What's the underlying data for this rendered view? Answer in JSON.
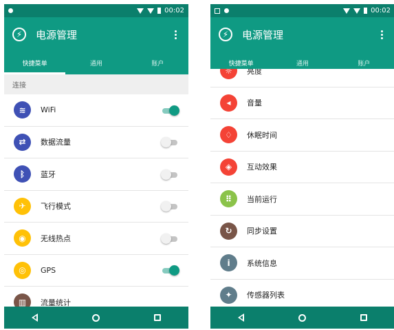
{
  "status": {
    "time": "00:02"
  },
  "app": {
    "title": "电源管理"
  },
  "tabs": [
    {
      "label": "快捷菜单"
    },
    {
      "label": "通用"
    },
    {
      "label": "账户"
    }
  ],
  "screen1": {
    "section": "连接",
    "items": [
      {
        "label": "WiFi",
        "icon": "wifi-icon",
        "color": "#3f51b5",
        "toggle": true
      },
      {
        "label": "数据流量",
        "icon": "data-transfer-icon",
        "color": "#3f51b5",
        "toggle": false
      },
      {
        "label": "蓝牙",
        "icon": "bluetooth-icon",
        "color": "#3f51b5",
        "toggle": false
      },
      {
        "label": "飞行模式",
        "icon": "airplane-icon",
        "color": "#ffc107",
        "toggle": false
      },
      {
        "label": "无线热点",
        "icon": "hotspot-icon",
        "color": "#ffc107",
        "toggle": false
      },
      {
        "label": "GPS",
        "icon": "gps-icon",
        "color": "#ffc107",
        "toggle": true
      },
      {
        "label": "流量统计",
        "icon": "chart-icon",
        "color": "#795548"
      }
    ]
  },
  "screen2": {
    "items": [
      {
        "label": "亮度",
        "icon": "brightness-icon",
        "color": "#f44336"
      },
      {
        "label": "音量",
        "icon": "volume-icon",
        "color": "#f44336"
      },
      {
        "label": "休眠时间",
        "icon": "alarm-icon",
        "color": "#f44336"
      },
      {
        "label": "互动效果",
        "icon": "effects-icon",
        "color": "#f44336"
      },
      {
        "label": "当前运行",
        "icon": "apps-grid-icon",
        "color": "#8bc34a"
      },
      {
        "label": "同步设置",
        "icon": "sync-icon",
        "color": "#795548"
      },
      {
        "label": "系统信息",
        "icon": "info-icon",
        "color": "#607d8b"
      },
      {
        "label": "传感器列表",
        "icon": "sensor-icon",
        "color": "#607d8b"
      }
    ]
  }
}
